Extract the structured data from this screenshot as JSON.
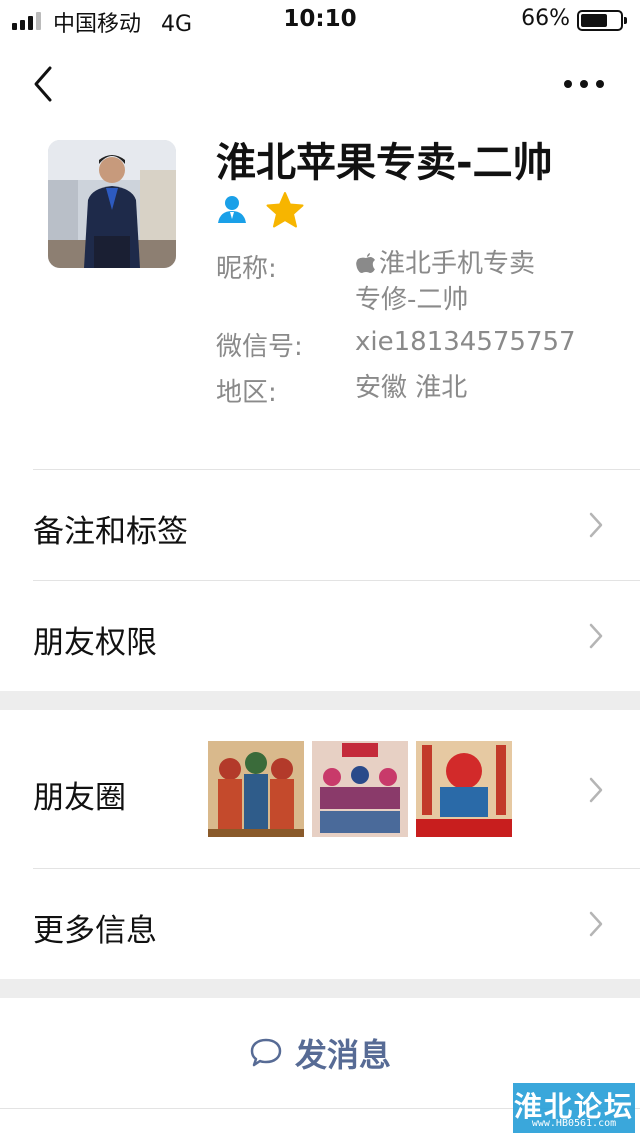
{
  "status_bar": {
    "carrier": "中国移动",
    "network": "4G",
    "time": "10:10",
    "battery_percent": "66%",
    "battery_level": 0.66,
    "signal_bars": 3
  },
  "header": {
    "back_icon": "chevron-left-icon",
    "more_icon": "more-dots-icon"
  },
  "profile": {
    "display_name": "淮北苹果专卖-二帅",
    "gender_badge_icon": "person-icon",
    "star_badge_icon": "star-icon",
    "star_color": "#f7b500",
    "person_badge_color": "#1aa0e8",
    "nickname_label": "昵称:",
    "nickname_line1": "淮北手机专卖",
    "nickname_line2": "专修-二帅",
    "wechat_id_label": "微信号:",
    "wechat_id": "xie18134575757",
    "region_label": "地区:",
    "region": "安徽 淮北"
  },
  "rows": {
    "remarks_tags": "备注和标签",
    "friend_permissions": "朋友权限",
    "moments": "朋友圈",
    "more_info": "更多信息"
  },
  "actions": {
    "send_message": "发消息",
    "send_message_color": "#576b95"
  },
  "watermark": {
    "title": "淮北论坛",
    "url": "www.HB0561.com"
  }
}
